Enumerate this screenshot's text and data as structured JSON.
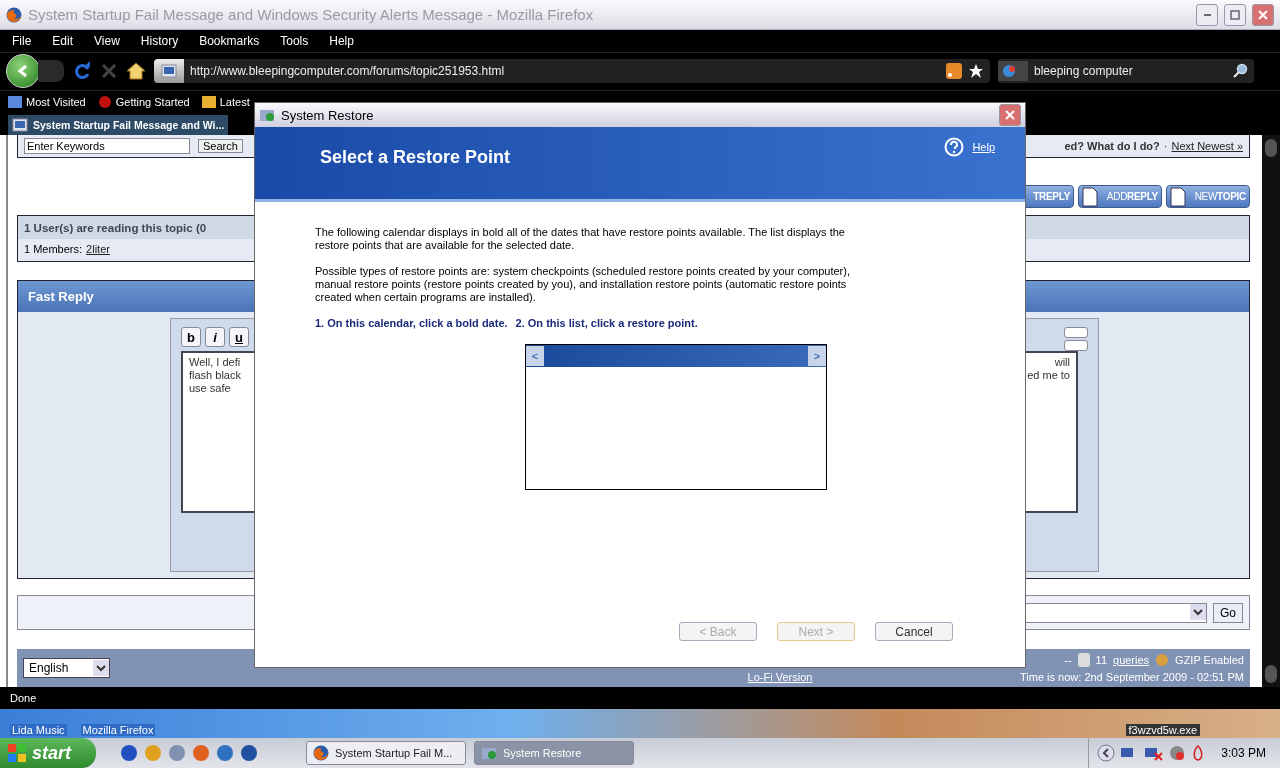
{
  "window": {
    "title": "System Startup Fail Message and Windows Security Alerts Message - Mozilla Firefox"
  },
  "menu": [
    "File",
    "Edit",
    "View",
    "History",
    "Bookmarks",
    "Tools",
    "Help"
  ],
  "address_bar": {
    "value": "http://www.bleepingcomputer.com/forums/topic251953.html"
  },
  "search_bar": {
    "value": "bleeping computer"
  },
  "bookmarks": [
    "Most Visited",
    "Getting Started",
    "Latest"
  ],
  "tabs": [
    {
      "label": "System Startup Fail Message and Wi...",
      "selected": true
    }
  ],
  "page": {
    "search": {
      "placeholder": "Enter Keywords",
      "button": "Search"
    },
    "topic_nav": {
      "title_fragment": "ed? What do I do?",
      "separator": "·",
      "next": "Next Newest »"
    },
    "action_buttons": [
      "**TREPLY**",
      "ADD**REPLY**",
      "NEW**TOPIC**"
    ],
    "readers": {
      "title": "1 User(s) are reading this topic (0",
      "members_label": "1 Members:",
      "member": "2liter"
    },
    "fast_reply": {
      "title": "Fast Reply",
      "format_buttons": [
        "b",
        "i",
        "u"
      ],
      "text_left": [
        "Well, I defi",
        "flash black",
        "use safe"
      ],
      "text_right": [
        "will",
        "ed me to"
      ]
    },
    "jump": {
      "button": "Go"
    },
    "footer": {
      "language": "English",
      "lofi": "Lo-Fi Version",
      "separator": "--",
      "queries_count": "11",
      "queries_link": "queries",
      "gzip": "GZIP Enabled",
      "time": "Time is now: 2nd September 2009 - 02:51 PM"
    }
  },
  "status_bar": {
    "text": "Done"
  },
  "dialog": {
    "title": "System Restore",
    "heading": "Select a Restore Point",
    "help": "Help",
    "paragraphs": [
      "The following calendar displays in bold all of the dates that have restore points available. The list displays the restore points that are available for the selected date.",
      "Possible types of restore points are: system checkpoints (scheduled restore points created by your computer), manual restore points (restore points created by you), and installation restore points (automatic restore points created when certain programs are installed)."
    ],
    "step1": "1. On this calendar, click a bold date.",
    "step2": "2. On this list, click a restore point.",
    "calendar": {
      "prev": "<",
      "next": ">"
    },
    "buttons": [
      {
        "label": "< Back",
        "disabled": true,
        "default": false
      },
      {
        "label": "Next >",
        "disabled": true,
        "default": true
      },
      {
        "label": "Cancel",
        "disabled": false,
        "default": false
      }
    ]
  },
  "desktop": {
    "icons": [
      "Lida Music",
      "Mozilla Firefox"
    ],
    "tooltip": "f3wzvd5w.exe"
  },
  "taskbar": {
    "start": "start",
    "tasks": [
      {
        "label": "System Startup Fail M...",
        "selected": false,
        "kind": "firefox"
      },
      {
        "label": "System Restore",
        "selected": true,
        "kind": "restore"
      }
    ],
    "clock": "3:03 PM"
  }
}
